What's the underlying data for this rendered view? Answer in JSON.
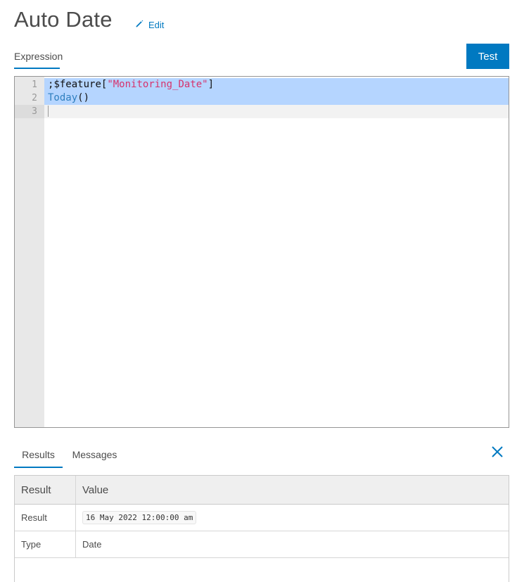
{
  "header": {
    "title": "Auto Date",
    "edit_label": "Edit"
  },
  "top_tabs": [
    {
      "label": "Expression",
      "active": true
    }
  ],
  "toolbar": {
    "test_label": "Test"
  },
  "editor": {
    "lines": [
      {
        "number": "1",
        "tokens": [
          ";",
          "$feature",
          "[",
          "\"Monitoring_Date\"",
          "]"
        ]
      },
      {
        "number": "2",
        "tokens": [
          "Today",
          "()"
        ]
      },
      {
        "number": "3",
        "tokens": []
      }
    ]
  },
  "bottom_tabs": [
    {
      "label": "Results",
      "active": true
    },
    {
      "label": "Messages",
      "active": false
    }
  ],
  "results": {
    "headers": [
      "Result",
      "Value"
    ],
    "rows": [
      {
        "key": "Result",
        "value": "16 May 2022 12:00:00 am"
      },
      {
        "key": "Type",
        "value": "Date"
      }
    ]
  },
  "colors": {
    "accent": "#0079c1",
    "selection": "#b5d5ff",
    "string": "#d6336c",
    "function": "#2f7fbf"
  },
  "icons": {
    "edit": "pencil-icon",
    "close": "close-icon"
  }
}
